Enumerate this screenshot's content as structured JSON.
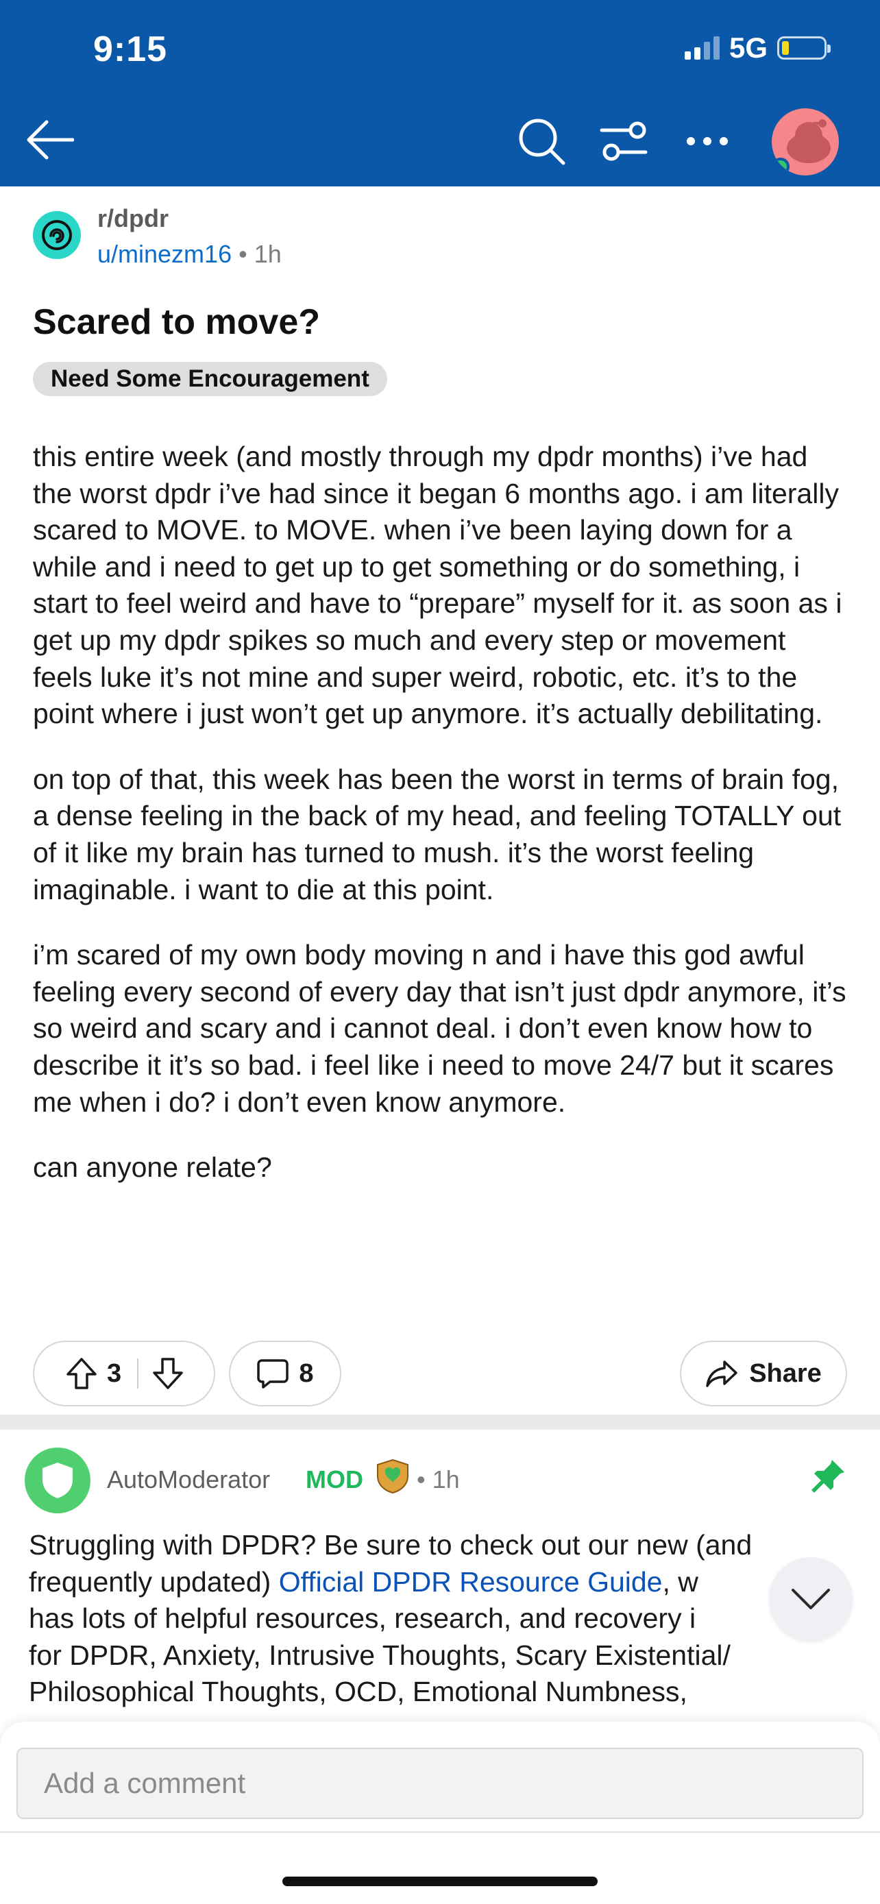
{
  "status_bar": {
    "time": "9:15",
    "network": "5G",
    "battery_level_fraction": 0.1,
    "battery_color": "#f4d91e"
  },
  "colors": {
    "header_bg": "#0c58a8",
    "author_link": "#0b6cc9",
    "mod_green": "#1fb85a",
    "link_blue": "#0b52b6"
  },
  "nav": {
    "icons": [
      "back-arrow-icon",
      "search-icon",
      "filter-sort-icon",
      "more-options-icon",
      "user-avatar"
    ]
  },
  "post": {
    "subreddit": "r/dpdr",
    "author": "u/minezm16",
    "separator": "•",
    "time": "1h",
    "title": "Scared to move?",
    "flair": "Need Some Encouragement",
    "paragraphs": [
      "this entire week (and mostly through my dpdr months) i’ve had the worst dpdr i’ve had since it began 6 months ago. i am literally scared to MOVE. to MOVE. when i’ve been laying down for a while and i need to get up to get something or do something, i start to feel weird and have to “prepare” myself for it. as soon as i get up my dpdr spikes so much and every step or movement feels luke it’s not mine and super weird, robotic, etc. it’s to the point where i just won’t get up anymore. it’s actually debilitating.",
      "on top of that, this week has been the worst in terms of brain fog, a dense feeling in the back of my head, and feeling TOTALLY out of it like my brain has turned to mush. it’s the worst feeling imaginable. i want to die at this point.",
      "i’m scared of my own body moving n and i have this god awful feeling every second of every day that isn’t just dpdr anymore, it’s so weird and scary and i cannot deal. i don’t even know how to describe it it’s so bad. i feel like i need to move 24/7 but it scares me when i do? i don’t even know anymore.",
      "can anyone relate?"
    ],
    "votes": "3",
    "comments": "8",
    "share_label": "Share"
  },
  "comment": {
    "author": "AutoModerator",
    "badge": "MOD",
    "separator": "•",
    "time": "1h",
    "body_before_link": "Struggling with DPDR? Be sure to check out our new (and frequently updated) ",
    "link_text": "Official DPDR Resource Guide",
    "body_after_link": ", w",
    "body_line3": "has lots of helpful resources, research, and recovery i",
    "body_line4": "for DPDR, Anxiety, Intrusive Thoughts, Scary Existential/",
    "body_line5": "Philosophical Thoughts, OCD, Emotional Numbness,"
  },
  "composer": {
    "placeholder": "Add a comment"
  }
}
